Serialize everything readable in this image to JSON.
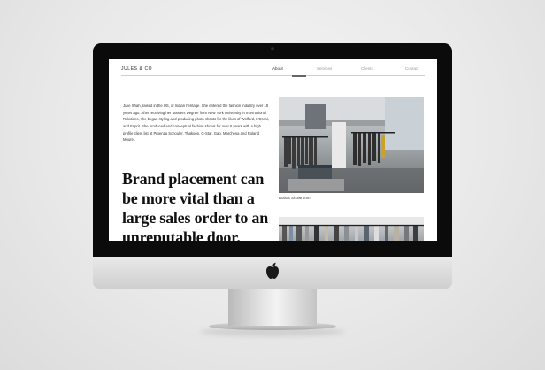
{
  "site": {
    "logo": "JULES & CO",
    "nav": [
      {
        "label": "About",
        "active": true
      },
      {
        "label": "Services",
        "active": false
      },
      {
        "label": "Clients",
        "active": false
      },
      {
        "label": "Contact",
        "active": false
      }
    ]
  },
  "about": {
    "bio": "Julie Shah, raised in the US, of Indian heritage. She entered the fashion industry over 18 years ago. After receiving her Masters Degree from New York University in International Relations, she began styling and producing photo shoots for the likes of Wolford, L'Oreal, and Esprit. She produced and conceptual fashion shows for over 6 years with a high profile client list at Proenza Schouler, Thakoon, G-Star, Gap, Marchesa and Roland Mouret.",
    "quote": "Brand placement can be more vital than a large sales order to an unreputable door.",
    "photo_caption": "Bobus Showroom"
  },
  "colors": {
    "screen_bezel": "#0b0b0b",
    "page_bg": "#ececec",
    "accent_text": "#111111"
  }
}
